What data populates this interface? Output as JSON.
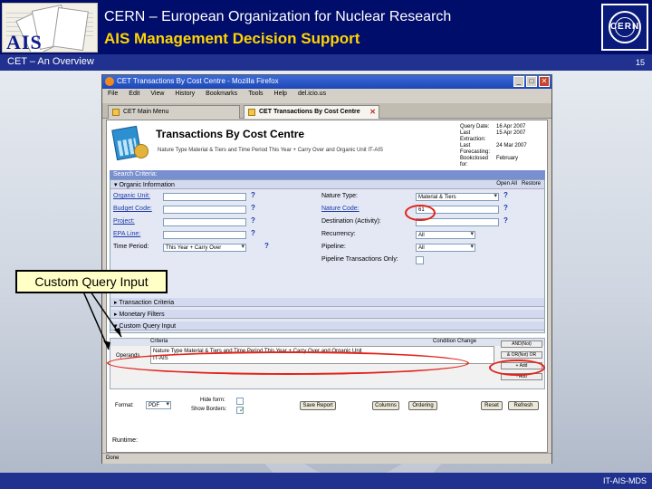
{
  "header": {
    "logo_text": "AIS",
    "title": "CERN – European Organization for Nuclear Research",
    "subtitle": "AIS Management Decision Support",
    "cern_logo_text": "CERN"
  },
  "subbar": {
    "left": "CET – An Overview",
    "page_number": "15"
  },
  "footer": {
    "text": "IT-AIS-MDS"
  },
  "callout": {
    "text": "Custom Query Input"
  },
  "browser": {
    "title": "CET Transactions By Cost Centre - Mozilla Firefox",
    "menu": [
      "File",
      "Edit",
      "View",
      "History",
      "Bookmarks",
      "Tools",
      "Help",
      "del.icio.us"
    ],
    "tabs": [
      {
        "label": "CET Main Menu"
      },
      {
        "label": "CET Transactions By Cost Centre"
      }
    ],
    "status": "Done"
  },
  "page": {
    "title": "Transactions By Cost Centre",
    "description": "Nature Type Material & Tiers and Time Period This Year + Carry Over and Organic Unit IT-AIS",
    "meta": [
      {
        "k": "Query Date:",
        "v": "16 Apr 2007"
      },
      {
        "k": "Last Extraction:",
        "v": "15 Apr 2007"
      },
      {
        "k": "Last Forecasting:",
        "v": "24 Mar 2007"
      },
      {
        "k": "Bookclosed for:",
        "v": "February"
      }
    ],
    "search_criteria": "Search Criteria:",
    "organic_information": "Organic Information",
    "open_all": "Open All",
    "restore": "Restore",
    "left_fields": [
      "Organic Unit:",
      "Budget Code:",
      "Project:",
      "EPA Line:",
      "Time Period:"
    ],
    "time_period_value": "This Year + Carry Over",
    "right_fields": [
      "Nature Type:",
      "Nature Code:",
      "Destination (Activity):",
      "Recurrency:",
      "Pipeline:",
      "Pipeline Transactions Only:"
    ],
    "nature_type_value": "Material & Tiers",
    "nature_code_value": "61",
    "recurrency_value": "All",
    "pipeline_value": "All",
    "sections": [
      "Transaction Criteria",
      "Monetary Filters",
      "Custom Query Input"
    ],
    "cq_criteria_label": "Criteria",
    "cq_condition_label": "Condition Change",
    "cq_operand_label": "Operands",
    "cq_text_line1": "Nature Type Material & Tiers and Time Period This Year + Carry Over and Organic Unit",
    "cq_text_line2": "IT-AIS",
    "cq_buttons": [
      "AND(Not)",
      "& OR(Not) OR",
      "+ Add",
      "- Add"
    ],
    "format_label": "Format:",
    "format_value": "PDF",
    "hide_form": "Hide form:",
    "show_borders": "Show Borders:",
    "action_buttons": [
      "Save Report",
      "Columns",
      "Ordering",
      "Reset",
      "Refresh"
    ],
    "runtime": "Runtime:"
  },
  "colors": {
    "header_bg": "#000d6b",
    "subtitle": "#ffd400",
    "highlight": "#e2231a"
  }
}
